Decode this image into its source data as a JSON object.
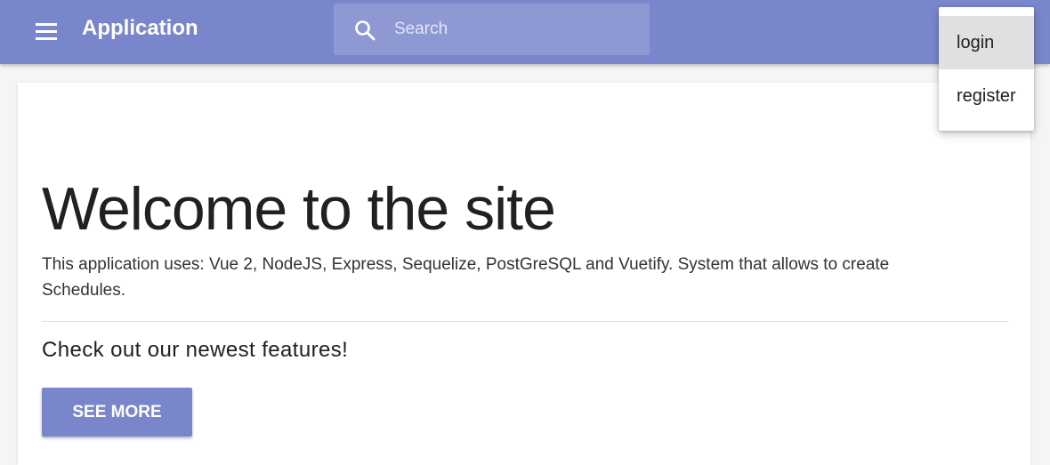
{
  "toolbar": {
    "title": "Application",
    "menu_icon": "hamburger-menu-icon",
    "search": {
      "placeholder": "Search",
      "value": "",
      "icon": "search-icon"
    },
    "color": "#7986cb"
  },
  "dropdown": {
    "items": [
      {
        "label": "login",
        "highlighted": true
      },
      {
        "label": "register",
        "highlighted": false
      }
    ]
  },
  "main": {
    "headline": "Welcome to the site",
    "description": "This application uses: Vue 2, NodeJS, Express, Sequelize, PostGreSQL and Vuetify. System that allows to create Schedules.",
    "subheading": "Check out our newest features!",
    "see_more_label": "See more"
  }
}
